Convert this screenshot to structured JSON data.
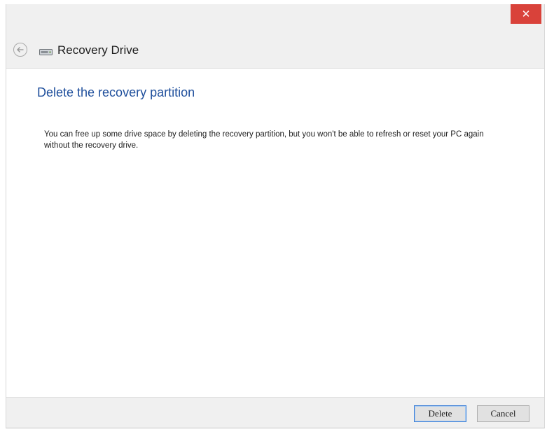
{
  "window": {
    "title": "Recovery Drive",
    "close_label": "✕"
  },
  "icons": {
    "back": "back-arrow-icon",
    "drive": "drive-icon"
  },
  "main": {
    "heading": "Delete the recovery partition",
    "description": "You can free up some drive space by deleting the recovery partition, but you won't be able to refresh or reset your PC again without the recovery drive."
  },
  "footer": {
    "delete_label": "Delete",
    "cancel_label": "Cancel"
  },
  "colors": {
    "close_button": "#d9423a",
    "heading": "#1f4f9c",
    "default_button_border": "#3c7fd6"
  }
}
